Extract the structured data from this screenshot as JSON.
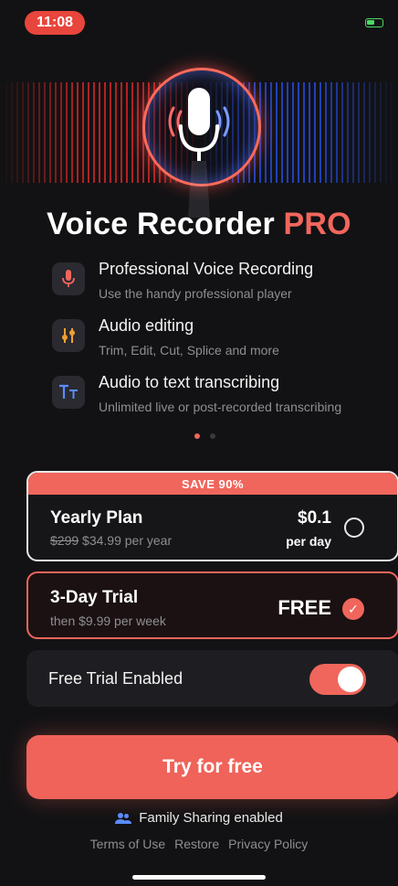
{
  "status": {
    "time": "11:08"
  },
  "title": {
    "main": "Voice Recorder",
    "highlight": "PRO"
  },
  "features": [
    {
      "icon": "microphone-icon",
      "title": "Professional Voice Recording",
      "subtitle": "Use the handy professional player"
    },
    {
      "icon": "sliders-icon",
      "title": "Audio editing",
      "subtitle": "Trim, Edit, Cut, Splice and more"
    },
    {
      "icon": "text-icon",
      "title": "Audio to text transcribing",
      "subtitle": "Unlimited live or post-recorded transcribing"
    }
  ],
  "plans": {
    "yearly": {
      "banner": "SAVE 90%",
      "name": "Yearly Plan",
      "old_price": "$299",
      "price_line": "$34.99 per year",
      "price": "$0.1",
      "price_unit": "per day",
      "selected": false
    },
    "trial": {
      "name": "3-Day Trial",
      "sub": "then $9.99 per week",
      "price": "FREE",
      "selected": true
    }
  },
  "toggle": {
    "label": "Free Trial Enabled",
    "on": true
  },
  "cta": {
    "label": "Try for free"
  },
  "family": {
    "label": "Family Sharing enabled"
  },
  "links": {
    "terms": "Terms of Use",
    "restore": "Restore",
    "privacy": "Privacy Policy"
  },
  "colors": {
    "accent": "#f0665c",
    "background": "#121214",
    "wave_left": "#e62828",
    "wave_right": "#2850f0"
  }
}
